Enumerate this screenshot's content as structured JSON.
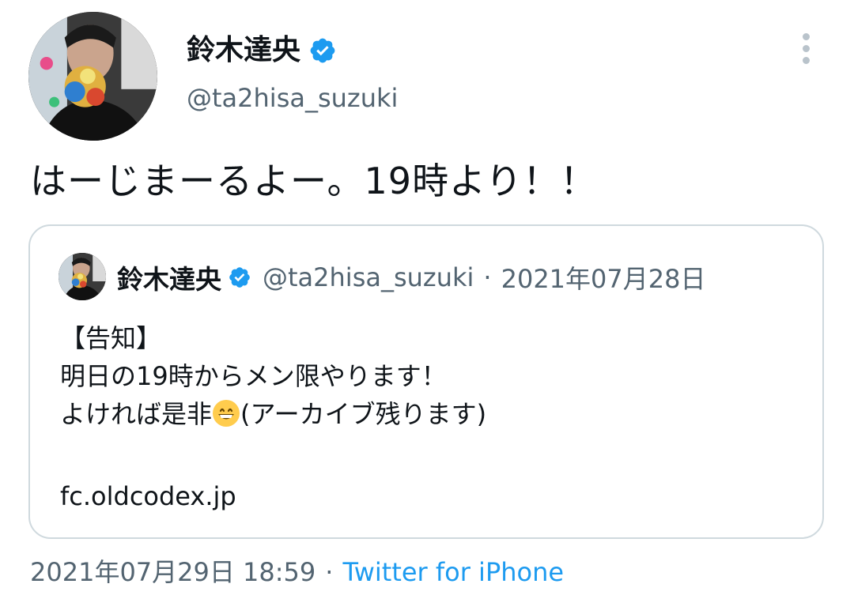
{
  "tweet": {
    "author": {
      "name": "鈴木達央",
      "handle": "@ta2hisa_suzuki",
      "verified": true
    },
    "text": "はーじまーるよー。19時より！！",
    "timestamp": "2021年07月29日 18:59",
    "separator": "·",
    "source": "Twitter for iPhone"
  },
  "quoted_tweet": {
    "author": {
      "name": "鈴木達央",
      "handle": "@ta2hisa_suzuki",
      "verified": true
    },
    "separator": "·",
    "date": "2021年07月28日",
    "lines": [
      "【告知】",
      "明日の19時からメン限やります！"
    ],
    "line3_before_emoji": "よければ是非",
    "line3_emoji": "grinning-face-emoji",
    "line3_after_emoji": "(アーカイブ残ります)",
    "link": "fc.oldcodex.jp"
  },
  "colors": {
    "text": "#0f1419",
    "secondary": "#536471",
    "link": "#1d9bf0",
    "verified": "#1d9bf0",
    "border": "#cfd9de"
  },
  "icons": {
    "verified": "verified-badge-icon",
    "more": "more-options-icon"
  }
}
